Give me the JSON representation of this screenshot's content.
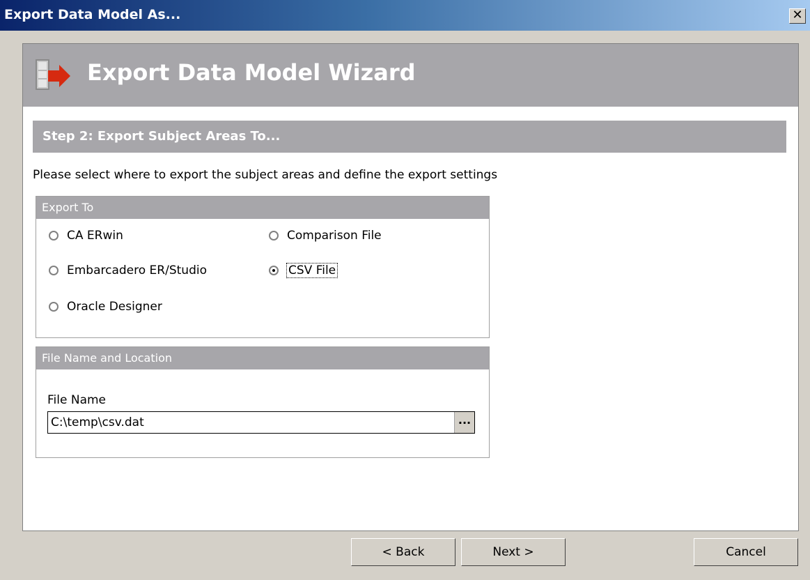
{
  "window": {
    "title": "Export Data Model As...",
    "close_glyph": "✕"
  },
  "header": {
    "title": "Export Data Model Wizard",
    "icon": "database-export-icon"
  },
  "step": {
    "title": "Step 2: Export Subject Areas To..."
  },
  "description": "Please select where to export the subject areas and define the export settings",
  "export_to": {
    "heading": "Export To",
    "options": [
      {
        "label": "CA ERwin",
        "selected": false
      },
      {
        "label": "Comparison File",
        "selected": false
      },
      {
        "label": "Embarcadero ER/Studio",
        "selected": false
      },
      {
        "label": "CSV File",
        "selected": true
      },
      {
        "label": "Oracle Designer",
        "selected": false
      }
    ]
  },
  "file": {
    "heading": "File Name and Location",
    "label": "File Name",
    "value": "C:\\temp\\csv.dat",
    "browse_label": "..."
  },
  "buttons": {
    "back": "< Back",
    "next": "Next >",
    "cancel": "Cancel"
  }
}
